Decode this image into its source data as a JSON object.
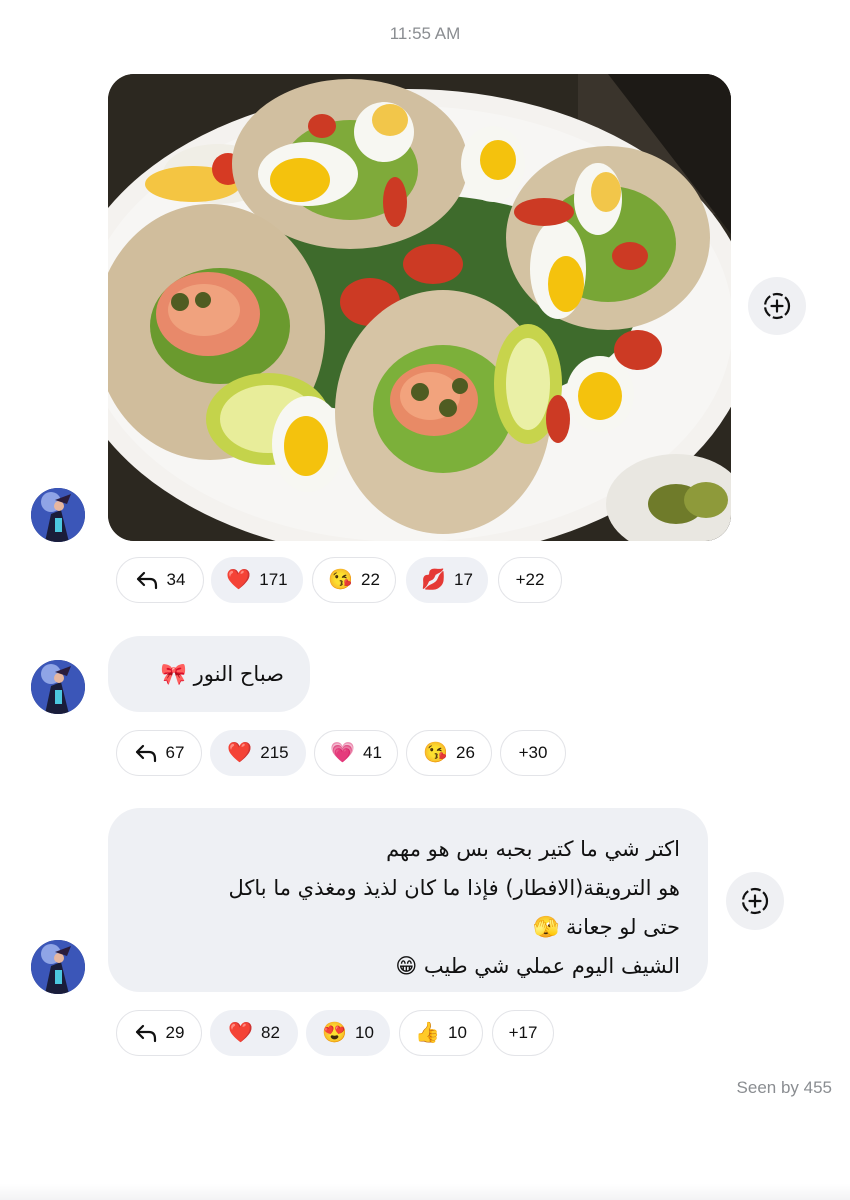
{
  "time": "11:55 AM",
  "messages": [
    {
      "type": "photo",
      "reactions": [
        {
          "icon": "reply-icon",
          "count": "34",
          "active": false
        },
        {
          "icon": "red-heart-emoji",
          "emoji": "❤️",
          "count": "171",
          "active": true
        },
        {
          "icon": "kissing-face-emoji",
          "emoji": "😘",
          "count": "22",
          "active": false
        },
        {
          "icon": "kiss-mark-emoji",
          "emoji": "💋",
          "count": "17",
          "active": true
        },
        {
          "icon": "more",
          "count": "+22",
          "active": false
        }
      ]
    },
    {
      "type": "text",
      "lines": [
        "صباح النور 🎀"
      ],
      "reactions": [
        {
          "icon": "reply-icon",
          "count": "67",
          "active": false
        },
        {
          "icon": "red-heart-emoji",
          "emoji": "❤️",
          "count": "215",
          "active": true
        },
        {
          "icon": "sparkling-heart-emoji",
          "emoji": "💗",
          "count": "41",
          "active": false
        },
        {
          "icon": "kissing-face-emoji",
          "emoji": "😘",
          "count": "26",
          "active": false
        },
        {
          "icon": "more",
          "count": "+30",
          "active": false
        }
      ]
    },
    {
      "type": "text",
      "lines": [
        "اكتر شي ما كتير بحبه بس هو مهم",
        "هو الترويقة(الافطار) فإذا ما كان لذيذ ومغذي ما باكل",
        "حتى لو جعانة 🫣",
        "الشيف اليوم عملي شي طيب 😁"
      ],
      "reactions": [
        {
          "icon": "reply-icon",
          "count": "29",
          "active": false
        },
        {
          "icon": "red-heart-emoji",
          "emoji": "❤️",
          "count": "82",
          "active": true
        },
        {
          "icon": "heart-eyes-emoji",
          "emoji": "😍",
          "count": "10",
          "active": true
        },
        {
          "icon": "thumbs-up-emoji",
          "emoji": "👍",
          "count": "10",
          "active": false
        },
        {
          "icon": "more",
          "count": "+17",
          "active": false
        }
      ]
    }
  ],
  "seen": "Seen by 455"
}
